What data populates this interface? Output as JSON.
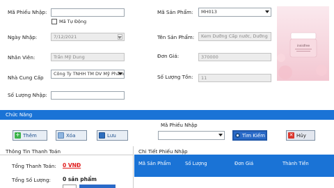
{
  "form": {
    "ma_phieu_nhap_label": "Mã Phiếu Nhập:",
    "ma_tu_dong_label": "Mã Tự Động",
    "ngay_nhap_label": "Ngày Nhập:",
    "ngay_nhap_value": "7/12/2021",
    "nhan_vien_label": "Nhân Viên:",
    "nhan_vien_value": "Trần Mỹ Dung",
    "nha_cung_cap_label": "Nhà Cung Cấp",
    "nha_cung_cap_value": "Công Ty TNHH TM DV Mỹ Phẩm",
    "so_luong_nhap_label": "Số Lượng Nhập:",
    "ma_san_pham_label": "Mã Sản Phẩm:",
    "ma_san_pham_value": "MH013",
    "ten_san_pham_label": "Tên Sản Phẩm:",
    "ten_san_pham_value": "Kem Dưỡng Cấp nước, Dưỡng",
    "don_gia_label": "Đơn Giá:",
    "don_gia_value": "370000",
    "so_luong_ton_label": "Số Lượng Tồn:",
    "so_luong_ton_value": "11"
  },
  "product_image": {
    "brand_text": "innisfree"
  },
  "chuc_nang": {
    "title": "Chức Năng",
    "them_label": "Thêm",
    "xoa_label": "Xóa",
    "luu_label": "Lưu",
    "search_label": "Mã Phiếu Nhập",
    "tim_kiem_label": "Tìm Kiếm",
    "huy_label": "Hủy"
  },
  "thanh_toan": {
    "title": "Thông Tin Thanh Toán",
    "tong_thanh_toan_label": "Tổng Thanh Toán:",
    "tong_thanh_toan_value": "0 VNĐ",
    "tong_so_luong_label": "Tổng Số Lượng:",
    "tong_so_luong_value": "0 sản phẩm"
  },
  "chi_tiet": {
    "title": "Chi Tiết Phiếu Nhập",
    "columns": [
      "Mã Sản Phẩm",
      "Số Lượng",
      "Đơn Giá",
      "Thành Tiền"
    ]
  },
  "colors": {
    "accent": "#1a73d6",
    "total_red": "#e01b1b"
  }
}
